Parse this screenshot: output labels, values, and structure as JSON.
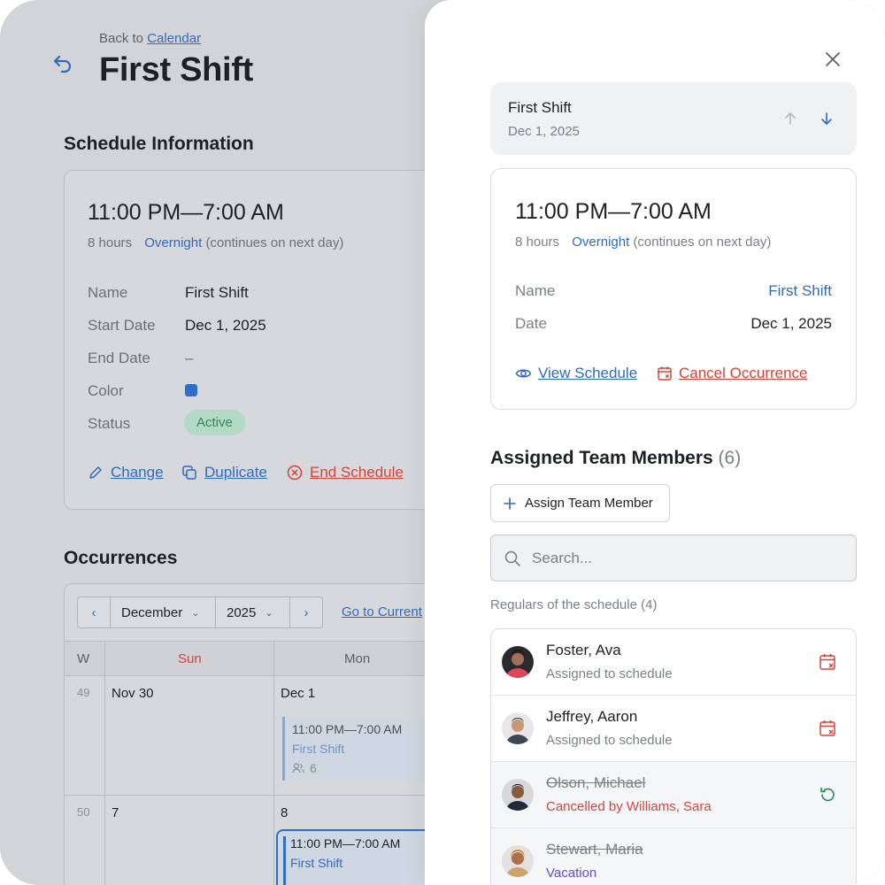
{
  "background": {
    "back_prefix": "Back to",
    "back_link": "Calendar",
    "page_title": "First Shift",
    "schedule_info": {
      "title": "Schedule Information",
      "time_range": "11:00 PM—7:00 AM",
      "duration": "8 hours",
      "overnight": "Overnight",
      "overnight_note": "(continues on next day)",
      "fields": [
        {
          "label": "Name",
          "value": "First Shift"
        },
        {
          "label": "Start Date",
          "value": "Dec 1, 2025"
        },
        {
          "label": "End Date",
          "value": "–"
        },
        {
          "label": "Color",
          "value": ""
        },
        {
          "label": "Status",
          "value": "Active"
        }
      ],
      "color_value": "#2b6fc9",
      "actions": {
        "change": "Change",
        "duplicate": "Duplicate",
        "end": "End Schedule"
      }
    },
    "occurrences": {
      "title": "Occurrences",
      "month": "December",
      "year": "2025",
      "go_current": "Go to Current",
      "headers": {
        "week": "W",
        "sun": "Sun",
        "mon": "Mon"
      },
      "weeks": [
        {
          "num": "49",
          "sun": "Nov 30",
          "mon": "Dec 1"
        },
        {
          "num": "50",
          "sun": "7",
          "mon": "8"
        }
      ],
      "event1": {
        "time": "11:00 PM—7:00 AM",
        "name": "First Shift",
        "count": "6"
      },
      "event2": {
        "time": "11:00 PM—7:00 AM",
        "name": "First Shift"
      }
    }
  },
  "panel": {
    "header": {
      "title": "First Shift",
      "date": "Dec 1, 2025"
    },
    "detail": {
      "time_range": "11:00 PM—7:00 AM",
      "duration": "8 hours",
      "overnight": "Overnight",
      "overnight_note": "(continues on next day)",
      "name_label": "Name",
      "name_value": "First Shift",
      "date_label": "Date",
      "date_value": "Dec 1, 2025",
      "view_schedule": "View Schedule",
      "cancel_occurrence": "Cancel Occurrence"
    },
    "team": {
      "title": "Assigned Team Members",
      "count": "(6)",
      "assign_button": "Assign Team Member",
      "search_placeholder": "Search...",
      "regulars_label": "Regulars of the schedule (4)",
      "members": [
        {
          "name": "Foster, Ava",
          "status": "Assigned to schedule"
        },
        {
          "name": "Jeffrey, Aaron",
          "status": "Assigned to schedule"
        },
        {
          "name": "Olson, Michael",
          "status": "Cancelled by Williams, Sara"
        },
        {
          "name": "Stewart, Maria",
          "status": "Vacation"
        }
      ]
    }
  },
  "colors": {
    "accent": "#2f6bbd",
    "danger": "#d1453b",
    "success": "#2d8a57",
    "vacation": "#6a4cc7"
  }
}
